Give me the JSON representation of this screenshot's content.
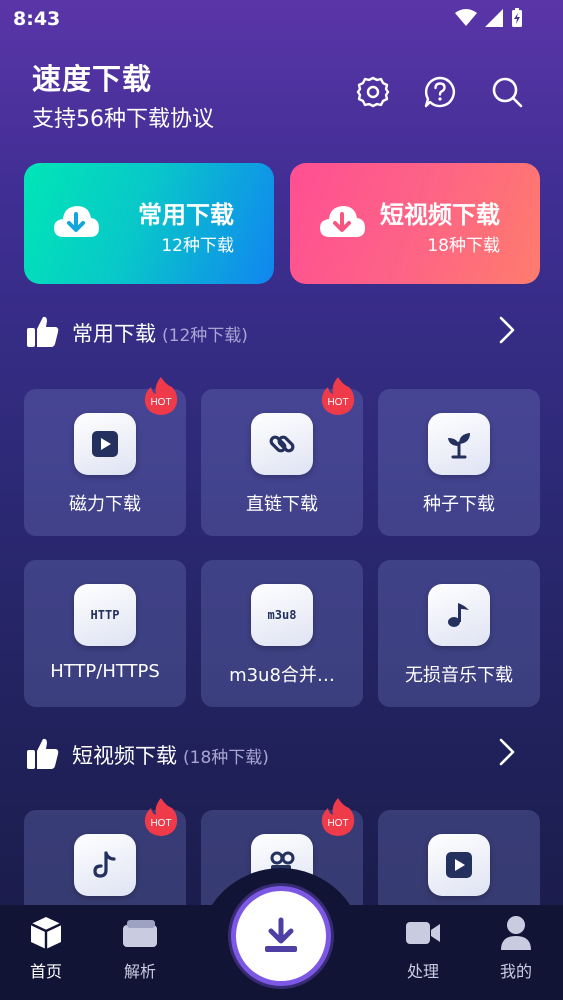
{
  "status_bar": {
    "time": "8:43"
  },
  "header": {
    "title": "速度下载",
    "subtitle": "支持56种下载协议",
    "icons": [
      "settings-icon",
      "help-icon",
      "search-icon"
    ]
  },
  "cards": [
    {
      "title": "常用下载",
      "subtitle": "12种下载",
      "color_start": "#00e6b6",
      "color_end": "#1185f0",
      "icon": "cloud-download-icon"
    },
    {
      "title": "短视频下载",
      "subtitle": "18种下载",
      "color_start": "#ff4f92",
      "color_end": "#ff7c6d",
      "icon": "cloud-download-icon"
    }
  ],
  "sections": [
    {
      "title": "常用下载",
      "count": "(12种下载)",
      "items": [
        {
          "label": "磁力下载",
          "icon": "play-icon",
          "hot": true
        },
        {
          "label": "直链下载",
          "icon": "link-icon",
          "hot": true
        },
        {
          "label": "种子下载",
          "icon": "sprout-icon",
          "hot": false
        },
        {
          "label": "HTTP/HTTPS",
          "icon": "http-icon",
          "icon_text": "HTTP",
          "hot": false
        },
        {
          "label": "m3u8合并…",
          "icon": "m3u8-icon",
          "icon_text": "m3u8",
          "hot": false
        },
        {
          "label": "无损音乐下载",
          "icon": "music-note-icon",
          "hot": false
        }
      ]
    },
    {
      "title": "短视频下载",
      "count": "(18种下载)",
      "items": [
        {
          "label": "",
          "icon": "tiktok-icon",
          "hot": true
        },
        {
          "label": "",
          "icon": "camera-icon",
          "hot": true
        },
        {
          "label": "",
          "icon": "play-icon",
          "hot": false
        }
      ]
    }
  ],
  "hot_badge": "HOT",
  "bottom_nav": [
    {
      "label": "首页",
      "icon": "cube-icon",
      "active": true
    },
    {
      "label": "解析",
      "icon": "folder-icon",
      "active": false
    },
    {
      "label": "处理",
      "icon": "video-camera-icon",
      "active": false
    },
    {
      "label": "我的",
      "icon": "user-icon",
      "active": false
    }
  ],
  "colors": {
    "accent": "#7c58e4",
    "nav_bg": "#121436",
    "icon_dark": "#24305e"
  }
}
